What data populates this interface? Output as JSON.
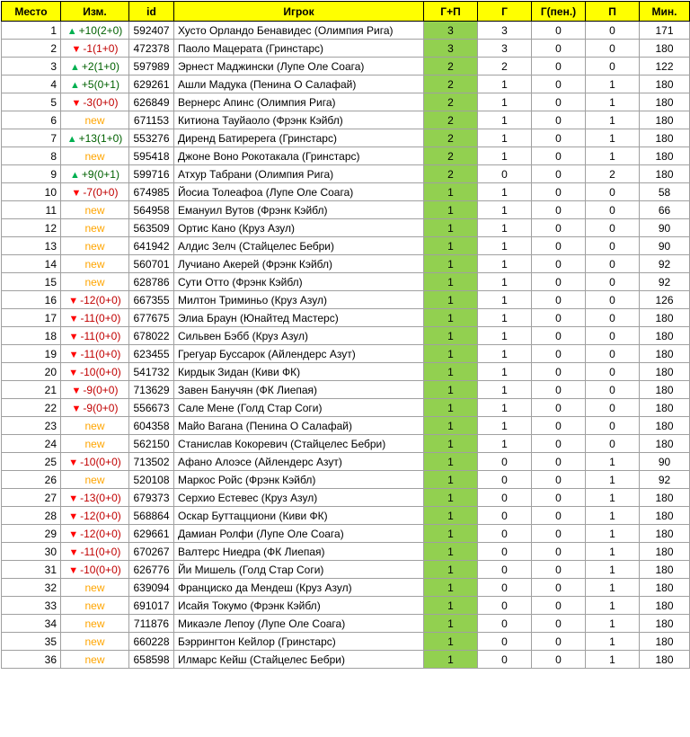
{
  "colors": {
    "header_bg": "#ffff00",
    "gp_bg": "#92d050",
    "up": "#00b050",
    "down": "#ff0000",
    "new": "#ffa500"
  },
  "icons": {
    "up": "triangle-up-icon",
    "down": "triangle-down-icon"
  },
  "columns": [
    "Место",
    "Изм.",
    "id",
    "Игрок",
    "Г+П",
    "Г",
    "Г(пен.)",
    "П",
    "Мин."
  ],
  "rows": [
    {
      "place": "1",
      "dir": "up",
      "change": "+10(2+0)",
      "id": "592407",
      "player": "Хусто Орландо Бенавидес (Олимпия Рига)",
      "gp": "3",
      "g": "3",
      "pen": "0",
      "a": "0",
      "min": "171"
    },
    {
      "place": "2",
      "dir": "down",
      "change": "-1(1+0)",
      "id": "472378",
      "player": "Паоло Мацерата (Гринстарс)",
      "gp": "3",
      "g": "3",
      "pen": "0",
      "a": "0",
      "min": "180"
    },
    {
      "place": "3",
      "dir": "up",
      "change": "+2(1+0)",
      "id": "597989",
      "player": "Эрнест Маджински (Лупе Оле Соага)",
      "gp": "2",
      "g": "2",
      "pen": "0",
      "a": "0",
      "min": "122"
    },
    {
      "place": "4",
      "dir": "up",
      "change": "+5(0+1)",
      "id": "629261",
      "player": "Ашли Мадука (Пенина О Салафай)",
      "gp": "2",
      "g": "1",
      "pen": "0",
      "a": "1",
      "min": "180"
    },
    {
      "place": "5",
      "dir": "down",
      "change": "-3(0+0)",
      "id": "626849",
      "player": "Вернерс Апинс (Олимпия Рига)",
      "gp": "2",
      "g": "1",
      "pen": "0",
      "a": "1",
      "min": "180"
    },
    {
      "place": "6",
      "dir": "new",
      "change": "new",
      "id": "671153",
      "player": "Китиона Тауйаоло (Фрэнк Кэйбл)",
      "gp": "2",
      "g": "1",
      "pen": "0",
      "a": "1",
      "min": "180"
    },
    {
      "place": "7",
      "dir": "up",
      "change": "+13(1+0)",
      "id": "553276",
      "player": "Диренд Батиререга (Гринстарс)",
      "gp": "2",
      "g": "1",
      "pen": "0",
      "a": "1",
      "min": "180"
    },
    {
      "place": "8",
      "dir": "new",
      "change": "new",
      "id": "595418",
      "player": "Джоне Воно Рокотакала (Гринстарс)",
      "gp": "2",
      "g": "1",
      "pen": "0",
      "a": "1",
      "min": "180"
    },
    {
      "place": "9",
      "dir": "up",
      "change": "+9(0+1)",
      "id": "599716",
      "player": "Атхур Табрани (Олимпия Рига)",
      "gp": "2",
      "g": "0",
      "pen": "0",
      "a": "2",
      "min": "180"
    },
    {
      "place": "10",
      "dir": "down",
      "change": "-7(0+0)",
      "id": "674985",
      "player": "Йосиа Толеафоа (Лупе Оле Соага)",
      "gp": "1",
      "g": "1",
      "pen": "0",
      "a": "0",
      "min": "58"
    },
    {
      "place": "11",
      "dir": "new",
      "change": "new",
      "id": "564958",
      "player": "Емануил Вутов (Фрэнк Кэйбл)",
      "gp": "1",
      "g": "1",
      "pen": "0",
      "a": "0",
      "min": "66"
    },
    {
      "place": "12",
      "dir": "new",
      "change": "new",
      "id": "563509",
      "player": "Ортис Кано (Круз Азул)",
      "gp": "1",
      "g": "1",
      "pen": "0",
      "a": "0",
      "min": "90"
    },
    {
      "place": "13",
      "dir": "new",
      "change": "new",
      "id": "641942",
      "player": "Алдис Зелч (Стайцелес Бебри)",
      "gp": "1",
      "g": "1",
      "pen": "0",
      "a": "0",
      "min": "90"
    },
    {
      "place": "14",
      "dir": "new",
      "change": "new",
      "id": "560701",
      "player": "Лучиано Акерей (Фрэнк Кэйбл)",
      "gp": "1",
      "g": "1",
      "pen": "0",
      "a": "0",
      "min": "92"
    },
    {
      "place": "15",
      "dir": "new",
      "change": "new",
      "id": "628786",
      "player": "Сути Отто (Фрэнк Кэйбл)",
      "gp": "1",
      "g": "1",
      "pen": "0",
      "a": "0",
      "min": "92"
    },
    {
      "place": "16",
      "dir": "down",
      "change": "-12(0+0)",
      "id": "667355",
      "player": "Милтон Триминьо (Круз Азул)",
      "gp": "1",
      "g": "1",
      "pen": "0",
      "a": "0",
      "min": "126"
    },
    {
      "place": "17",
      "dir": "down",
      "change": "-11(0+0)",
      "id": "677675",
      "player": "Элиа Браун (Юнайтед Мастерс)",
      "gp": "1",
      "g": "1",
      "pen": "0",
      "a": "0",
      "min": "180"
    },
    {
      "place": "18",
      "dir": "down",
      "change": "-11(0+0)",
      "id": "678022",
      "player": "Сильвен Бэбб (Круз Азул)",
      "gp": "1",
      "g": "1",
      "pen": "0",
      "a": "0",
      "min": "180"
    },
    {
      "place": "19",
      "dir": "down",
      "change": "-11(0+0)",
      "id": "623455",
      "player": "Грегуар Буссарок (Айлендерс Азут)",
      "gp": "1",
      "g": "1",
      "pen": "0",
      "a": "0",
      "min": "180"
    },
    {
      "place": "20",
      "dir": "down",
      "change": "-10(0+0)",
      "id": "541732",
      "player": "Кирдык Зидан (Киви ФК)",
      "gp": "1",
      "g": "1",
      "pen": "0",
      "a": "0",
      "min": "180"
    },
    {
      "place": "21",
      "dir": "down",
      "change": "-9(0+0)",
      "id": "713629",
      "player": "Завен Банучян (ФК Лиепая)",
      "gp": "1",
      "g": "1",
      "pen": "0",
      "a": "0",
      "min": "180"
    },
    {
      "place": "22",
      "dir": "down",
      "change": "-9(0+0)",
      "id": "556673",
      "player": "Сале Мене (Голд Стар Соги)",
      "gp": "1",
      "g": "1",
      "pen": "0",
      "a": "0",
      "min": "180"
    },
    {
      "place": "23",
      "dir": "new",
      "change": "new",
      "id": "604358",
      "player": "Майо Вагана (Пенина О Салафай)",
      "gp": "1",
      "g": "1",
      "pen": "0",
      "a": "0",
      "min": "180"
    },
    {
      "place": "24",
      "dir": "new",
      "change": "new",
      "id": "562150",
      "player": "Станислав Кокоревич (Стайцелес Бебри)",
      "gp": "1",
      "g": "1",
      "pen": "0",
      "a": "0",
      "min": "180"
    },
    {
      "place": "25",
      "dir": "down",
      "change": "-10(0+0)",
      "id": "713502",
      "player": "Афано Алоэсе (Айлендерс Азут)",
      "gp": "1",
      "g": "0",
      "pen": "0",
      "a": "1",
      "min": "90"
    },
    {
      "place": "26",
      "dir": "new",
      "change": "new",
      "id": "520108",
      "player": "Маркос Ройс (Фрэнк Кэйбл)",
      "gp": "1",
      "g": "0",
      "pen": "0",
      "a": "1",
      "min": "92"
    },
    {
      "place": "27",
      "dir": "down",
      "change": "-13(0+0)",
      "id": "679373",
      "player": "Серхио Естевес (Круз Азул)",
      "gp": "1",
      "g": "0",
      "pen": "0",
      "a": "1",
      "min": "180"
    },
    {
      "place": "28",
      "dir": "down",
      "change": "-12(0+0)",
      "id": "568864",
      "player": "Оскар Буттацциони (Киви ФК)",
      "gp": "1",
      "g": "0",
      "pen": "0",
      "a": "1",
      "min": "180"
    },
    {
      "place": "29",
      "dir": "down",
      "change": "-12(0+0)",
      "id": "629661",
      "player": "Дамиан Ролфи (Лупе Оле Соага)",
      "gp": "1",
      "g": "0",
      "pen": "0",
      "a": "1",
      "min": "180"
    },
    {
      "place": "30",
      "dir": "down",
      "change": "-11(0+0)",
      "id": "670267",
      "player": "Валтерс Ниедра (ФК Лиепая)",
      "gp": "1",
      "g": "0",
      "pen": "0",
      "a": "1",
      "min": "180"
    },
    {
      "place": "31",
      "dir": "down",
      "change": "-10(0+0)",
      "id": "626776",
      "player": "Йи Мишель (Голд Стар Соги)",
      "gp": "1",
      "g": "0",
      "pen": "0",
      "a": "1",
      "min": "180"
    },
    {
      "place": "32",
      "dir": "new",
      "change": "new",
      "id": "639094",
      "player": "Франциско да Мендеш (Круз Азул)",
      "gp": "1",
      "g": "0",
      "pen": "0",
      "a": "1",
      "min": "180"
    },
    {
      "place": "33",
      "dir": "new",
      "change": "new",
      "id": "691017",
      "player": "Исайя Токумо (Фрэнк Кэйбл)",
      "gp": "1",
      "g": "0",
      "pen": "0",
      "a": "1",
      "min": "180"
    },
    {
      "place": "34",
      "dir": "new",
      "change": "new",
      "id": "711876",
      "player": "Микаэле Лепоу (Лупе Оле Соага)",
      "gp": "1",
      "g": "0",
      "pen": "0",
      "a": "1",
      "min": "180"
    },
    {
      "place": "35",
      "dir": "new",
      "change": "new",
      "id": "660228",
      "player": "Бэррингтон Кейлор (Гринстарс)",
      "gp": "1",
      "g": "0",
      "pen": "0",
      "a": "1",
      "min": "180"
    },
    {
      "place": "36",
      "dir": "new",
      "change": "new",
      "id": "658598",
      "player": "Илмарс Кейш (Стайцелес Бебри)",
      "gp": "1",
      "g": "0",
      "pen": "0",
      "a": "1",
      "min": "180"
    }
  ]
}
